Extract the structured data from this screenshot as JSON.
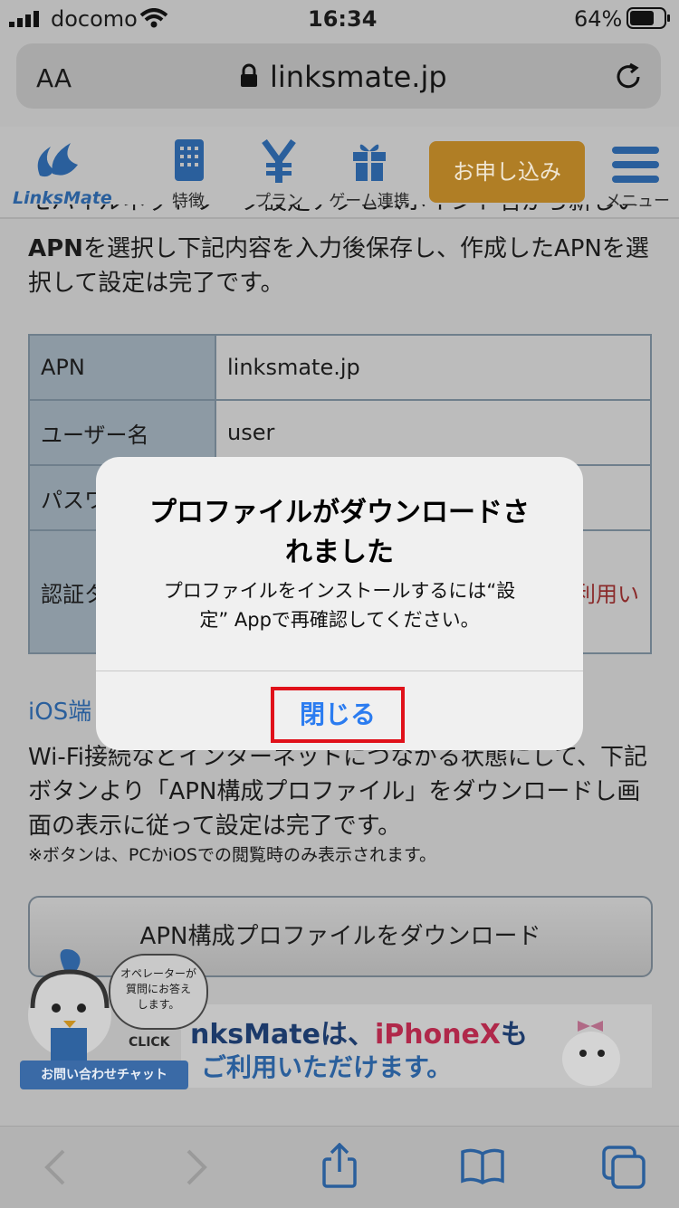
{
  "status_bar": {
    "carrier": "docomo",
    "time": "16:34",
    "battery": "64%"
  },
  "browser": {
    "text_size_label": "AA",
    "url": "linksmate.jp"
  },
  "site_header": {
    "logo_text": "LinksMate",
    "nav": [
      {
        "label": "特徴",
        "icon": "building-icon"
      },
      {
        "label": "プラン",
        "icon": "yen-icon"
      },
      {
        "label": "ゲーム連携",
        "icon": "gift-icon"
      }
    ],
    "apply_label": "お申し込み",
    "menu_label": "メニュー",
    "apply_color": "#b07e25"
  },
  "content": {
    "partial_top": "モバイルネットワーク設定アクセスポイント名から新しい",
    "intro_bold": "APN",
    "intro_rest": "を選択し下記内容を入力後保存し、作成したAPNを選",
    "intro_line2": "択して設定は完了です。",
    "table": [
      {
        "key": "APN",
        "value": "linksmate.jp"
      },
      {
        "key": "ユーザー名",
        "value": "user"
      },
      {
        "key": "パスワ",
        "value": ""
      },
      {
        "key": "認証タ",
        "value": "利用い"
      }
    ],
    "ios_heading": "iOS端",
    "ios_text": [
      "Wi-Fi接続などインターネットにつながる状態にして、下記",
      "ボタンより「APN構成プロファイル」をダウンロードし画",
      "面の表示に従って設定は完了です。"
    ],
    "note": "※ボタンは、PCかiOSでの閲覧時のみ表示されます。",
    "download_label": "APN構成プロファイルをダウンロード"
  },
  "chat_widget": {
    "bubble_lines": [
      "オペレーターが",
      "質問にお答え",
      "します。"
    ],
    "click_label": "CLICK",
    "label": "お問い合わせチャット"
  },
  "banner": {
    "line1_a": "nksMateは、",
    "line1_b": "iPhoneX",
    "line1_c": "も",
    "line2": "ご利用いただけます。"
  },
  "dialog": {
    "title_line1": "プロファイルがダウンロードさ",
    "title_line2": "れました",
    "message_line1": "プロファイルをインストールするには“設",
    "message_line2": "定” Appで再確認してください。",
    "close_label": "閉じる",
    "accent_color": "#2b7cf0",
    "highlight_color": "#e0111a"
  },
  "toolbar": {
    "icons": [
      "back-icon",
      "forward-icon",
      "share-icon",
      "bookmarks-icon",
      "tabs-icon"
    ]
  }
}
